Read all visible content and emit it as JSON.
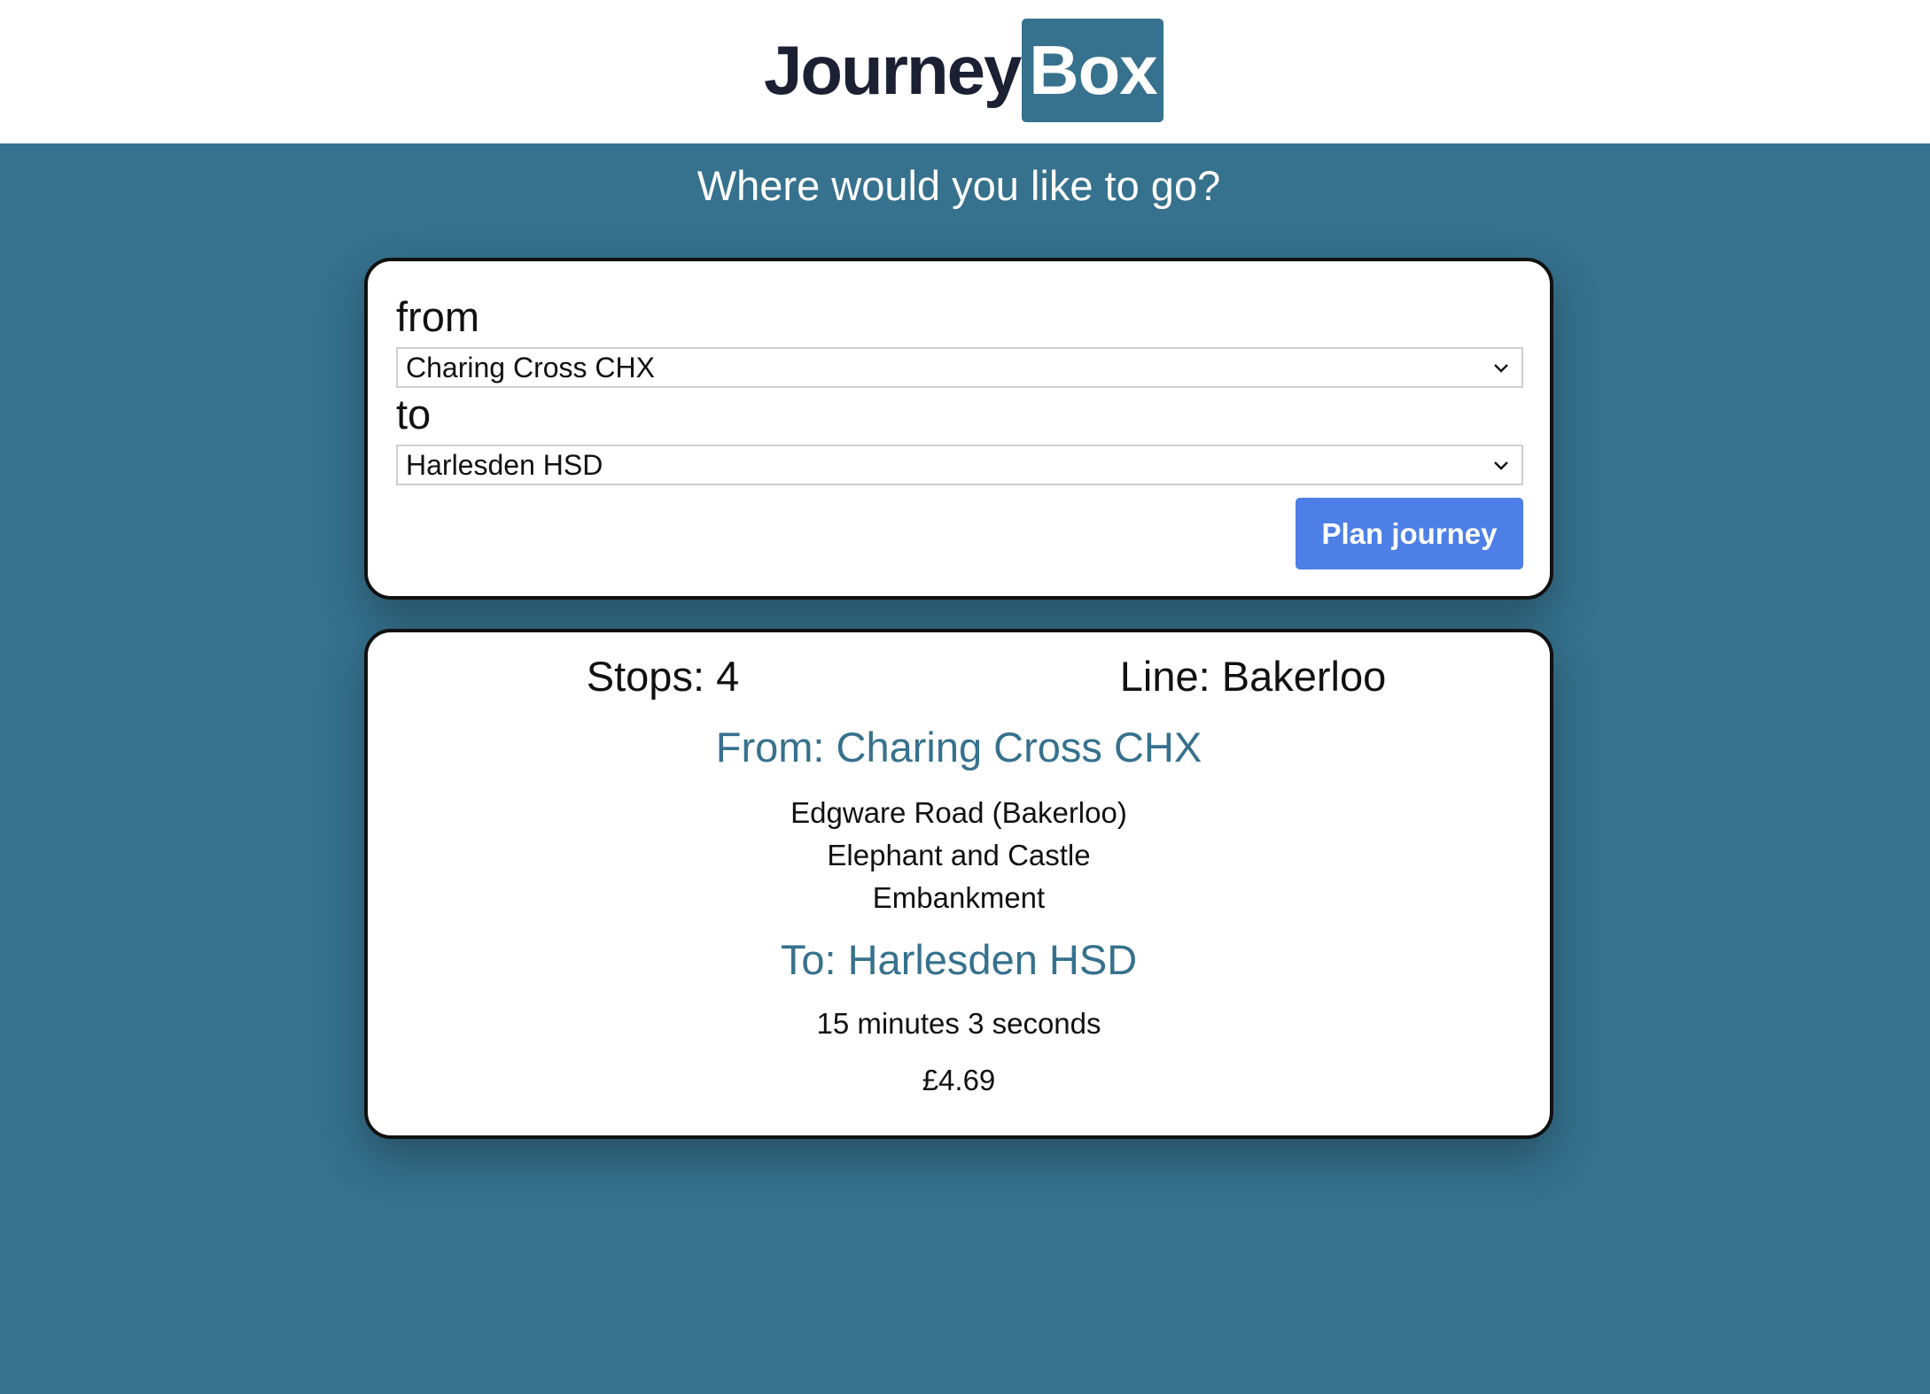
{
  "brand": {
    "word": "Journey",
    "box": "Box",
    "accent_color": "#36718d"
  },
  "tagline": "Where would you like to go?",
  "form": {
    "from_label": "from",
    "from_value": "Charing Cross CHX",
    "to_label": "to",
    "to_value": "Harlesden HSD",
    "submit_label": "Plan journey",
    "button_color": "#4d7fe6"
  },
  "result": {
    "stops": "Stops: 4",
    "line": "Line: Bakerloo",
    "from": "From: Charing Cross CHX",
    "intermediate_stops": [
      "Edgware Road (Bakerloo)",
      "Elephant and Castle",
      "Embankment"
    ],
    "to": "To: Harlesden HSD",
    "duration": "15 minutes 3 seconds",
    "fare": "£4.69"
  }
}
